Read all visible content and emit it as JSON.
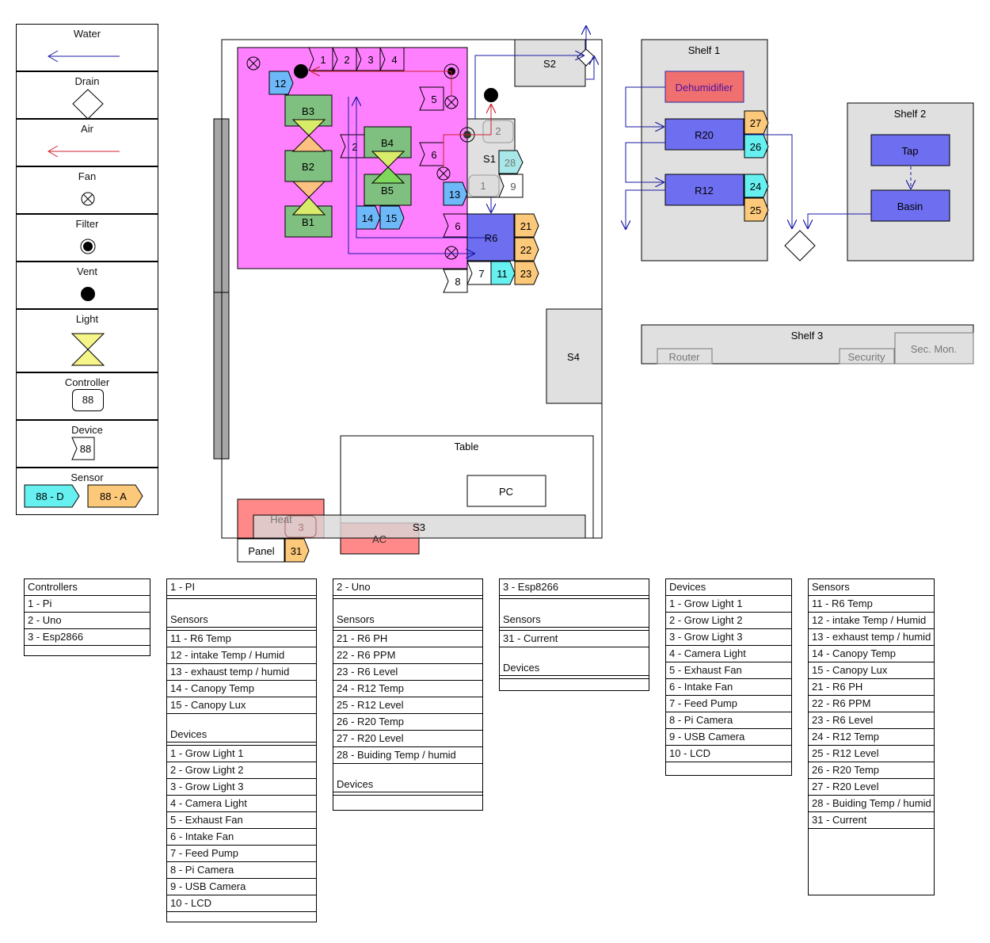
{
  "legend": {
    "items": [
      {
        "label": "Water",
        "icon": "water-arrow-icon"
      },
      {
        "label": "Drain",
        "icon": "drain-diamond-icon"
      },
      {
        "label": "Air",
        "icon": "air-arrow-icon"
      },
      {
        "label": "Fan",
        "icon": "fan-icon"
      },
      {
        "label": "Filter",
        "icon": "filter-icon"
      },
      {
        "label": "Vent",
        "icon": "vent-icon"
      },
      {
        "label": "Light",
        "icon": "light-icon"
      },
      {
        "label": "Controller",
        "icon": "controller-icon",
        "sample": "88"
      },
      {
        "label": "Device",
        "icon": "device-icon",
        "sample": "88"
      },
      {
        "label": "Sensor",
        "icon": "sensor-icon",
        "digital": "88 - D",
        "analog": "88 - A"
      }
    ],
    "colors": {
      "water": "#1a1aa6",
      "air": "#d01f2f",
      "digital_sensor": "#66f0f0",
      "analog_sensor": "#fcc87a",
      "light": "#f5f58a"
    }
  },
  "floorplan": {
    "grow_tent": {
      "color": "#ff80ff"
    },
    "buckets": [
      "B3",
      "B2",
      "B1",
      "B4",
      "B5"
    ],
    "devices_top": [
      "1",
      "2",
      "3",
      "4"
    ],
    "device_5": "5",
    "device_6a": "6",
    "device_6b": "6",
    "device_2": "2",
    "device_7": "7",
    "device_8": "8",
    "device_9": "9",
    "sensor_12": "12",
    "sensor_13": "13",
    "sensor_14": "14",
    "sensor_15": "15",
    "sensor_11": "11",
    "sensor_21": "21",
    "sensor_22": "22",
    "sensor_23": "23",
    "sensor_28": "28",
    "controller_1": "1",
    "controller_2": "2",
    "controller_3": "3",
    "reservoir_r6": "R6",
    "s1": "S1",
    "s2": "S2",
    "s3": "S3",
    "s4": "S4",
    "table": "Table",
    "pc": "PC",
    "heat": "Heat",
    "ac": "AC",
    "panel": "Panel",
    "sensor_31": "31"
  },
  "shelves": {
    "shelf1": {
      "title": "Shelf 1",
      "dehumidifier": "Dehumidifier",
      "r20": "R20",
      "r12": "R12",
      "s27": "27",
      "s26": "26",
      "s24": "24",
      "s25": "25"
    },
    "shelf2": {
      "title": "Shelf 2",
      "tap": "Tap",
      "basin": "Basin"
    },
    "shelf3": {
      "title": "Shelf 3",
      "router": "Router",
      "security": "Security",
      "sec_mon": "Sec. Mon."
    }
  },
  "tables": {
    "controllers": {
      "header": "Controllers",
      "rows": [
        "1 - Pi",
        "2 - Uno",
        "3 - Esp2866"
      ]
    },
    "pi": {
      "header": "1 - PI",
      "sensors_label": "Sensors",
      "sensors": [
        "11 - R6 Temp",
        "12 - intake Temp / Humid",
        "13 - exhaust temp / humid",
        "14 - Canopy Temp",
        "15 - Canopy Lux"
      ],
      "devices_label": "Devices",
      "devices": [
        "1 - Grow Light 1",
        "2 - Grow Light 2",
        "3 - Grow Light 3",
        "4 - Camera Light",
        "5 - Exhaust Fan",
        "6 - Intake Fan",
        "7 - Feed Pump",
        "8 - Pi Camera",
        "9 - USB Camera",
        "10 - LCD"
      ]
    },
    "uno": {
      "header": "2 - Uno",
      "sensors_label": "Sensors",
      "sensors": [
        "21 - R6 PH",
        "22 - R6 PPM",
        "23 - R6 Level",
        "24 - R12 Temp",
        "25 - R12 Level",
        "26 - R20 Temp",
        "27 - R20 Level",
        "28 - Buiding Temp / humid"
      ],
      "devices_label": "Devices"
    },
    "esp": {
      "header": "3 - Esp8266",
      "sensors_label": "Sensors",
      "sensors": [
        "31 - Current"
      ],
      "devices_label": "Devices"
    },
    "devices": {
      "header": "Devices",
      "rows": [
        "1 - Grow Light 1",
        "2 - Grow Light 2",
        "3 - Grow Light 3",
        "4 - Camera Light",
        "5 - Exhaust Fan",
        "6 - Intake Fan",
        "7 - Feed Pump",
        "8 - Pi Camera",
        "9 - USB Camera",
        "10 - LCD"
      ]
    },
    "sensors": {
      "header": "Sensors",
      "rows": [
        "11 - R6 Temp",
        "12 - intake Temp / Humid",
        "13 - exhaust temp / humid",
        "14 - Canopy Temp",
        "15 - Canopy Lux",
        "21 - R6 PH",
        "22 - R6 PPM",
        "23 - R6 Level",
        "24 - R12 Temp",
        "25 - R12 Level",
        "26 - R20 Temp",
        "27 - R20 Level",
        "28 - Buiding Temp / humid",
        "31 - Current"
      ]
    }
  }
}
